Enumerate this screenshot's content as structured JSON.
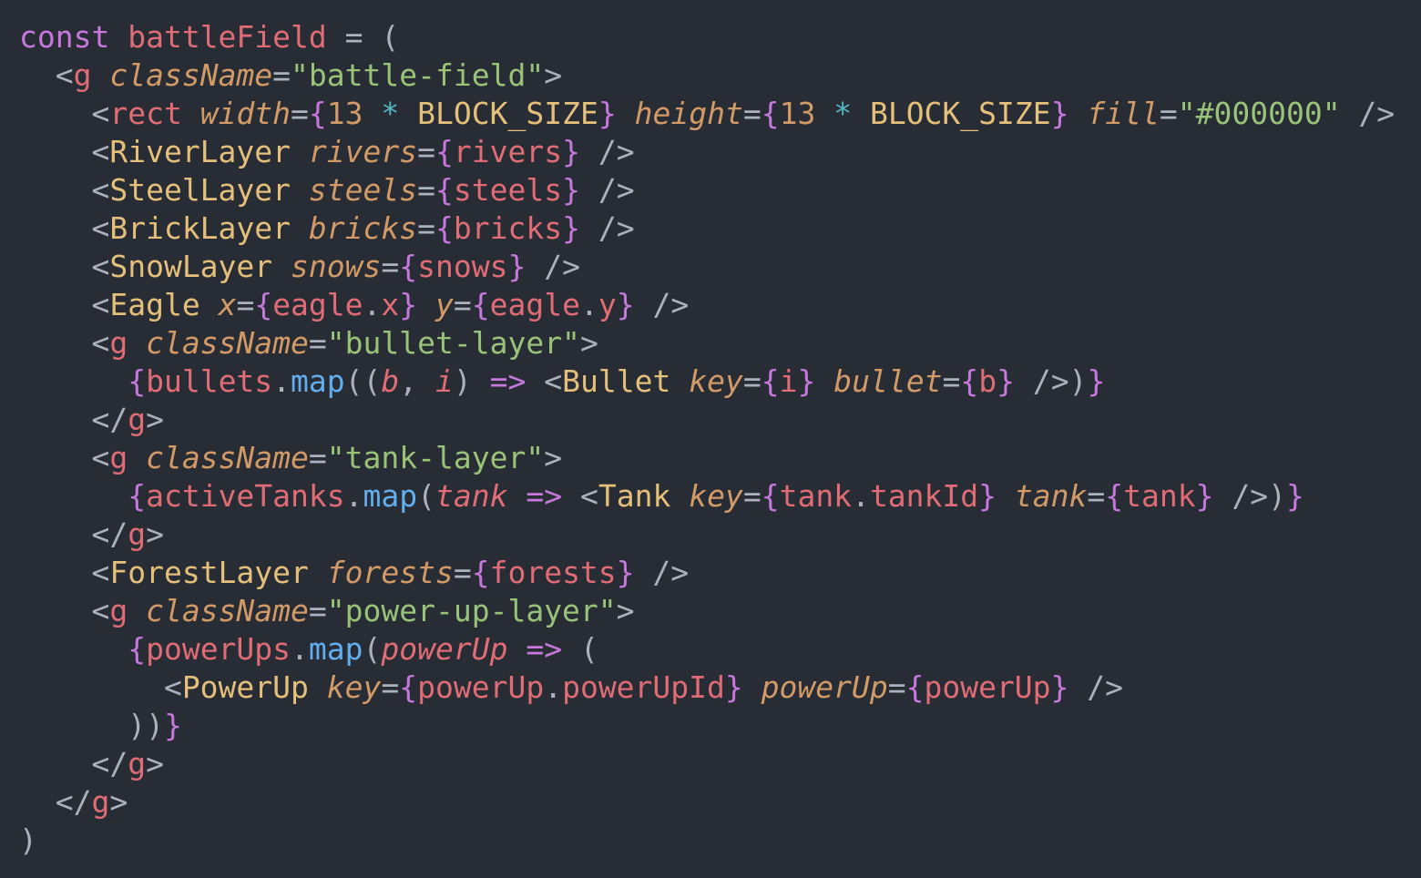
{
  "editor": {
    "theme": "one-dark",
    "background": "#282c34",
    "language": "jsx",
    "lines": [
      [
        [
          "keyword",
          "const"
        ],
        [
          "punct",
          " "
        ],
        [
          "var",
          "battleField"
        ],
        [
          "op",
          " = ("
        ]
      ],
      [
        [
          "punct",
          "  <"
        ],
        [
          "tag",
          "g"
        ],
        [
          "punct",
          " "
        ],
        [
          "attr",
          "className"
        ],
        [
          "op",
          "="
        ],
        [
          "string",
          "\"battle-field\""
        ],
        [
          "punct",
          ">"
        ]
      ],
      [
        [
          "punct",
          "    <"
        ],
        [
          "tag",
          "rect"
        ],
        [
          "punct",
          " "
        ],
        [
          "attr",
          "width"
        ],
        [
          "op",
          "="
        ],
        [
          "brace",
          "{"
        ],
        [
          "number",
          "13"
        ],
        [
          "punct",
          " "
        ],
        [
          "star",
          "*"
        ],
        [
          "punct",
          " "
        ],
        [
          "const",
          "BLOCK_SIZE"
        ],
        [
          "brace",
          "}"
        ],
        [
          "punct",
          " "
        ],
        [
          "attr",
          "height"
        ],
        [
          "op",
          "="
        ],
        [
          "brace",
          "{"
        ],
        [
          "number",
          "13"
        ],
        [
          "punct",
          " "
        ],
        [
          "star",
          "*"
        ],
        [
          "punct",
          " "
        ],
        [
          "const",
          "BLOCK_SIZE"
        ],
        [
          "brace",
          "}"
        ],
        [
          "punct",
          " "
        ],
        [
          "attr",
          "fill"
        ],
        [
          "op",
          "="
        ],
        [
          "string",
          "\"#000000\""
        ],
        [
          "punct",
          " />"
        ]
      ],
      [
        [
          "punct",
          "    <"
        ],
        [
          "component",
          "RiverLayer"
        ],
        [
          "punct",
          " "
        ],
        [
          "attr",
          "rivers"
        ],
        [
          "op",
          "="
        ],
        [
          "brace",
          "{"
        ],
        [
          "ident",
          "rivers"
        ],
        [
          "brace",
          "}"
        ],
        [
          "punct",
          " />"
        ]
      ],
      [
        [
          "punct",
          "    <"
        ],
        [
          "component",
          "SteelLayer"
        ],
        [
          "punct",
          " "
        ],
        [
          "attr",
          "steels"
        ],
        [
          "op",
          "="
        ],
        [
          "brace",
          "{"
        ],
        [
          "ident",
          "steels"
        ],
        [
          "brace",
          "}"
        ],
        [
          "punct",
          " />"
        ]
      ],
      [
        [
          "punct",
          "    <"
        ],
        [
          "component",
          "BrickLayer"
        ],
        [
          "punct",
          " "
        ],
        [
          "attr",
          "bricks"
        ],
        [
          "op",
          "="
        ],
        [
          "brace",
          "{"
        ],
        [
          "ident",
          "bricks"
        ],
        [
          "brace",
          "}"
        ],
        [
          "punct",
          " />"
        ]
      ],
      [
        [
          "punct",
          "    <"
        ],
        [
          "component",
          "SnowLayer"
        ],
        [
          "punct",
          " "
        ],
        [
          "attr",
          "snows"
        ],
        [
          "op",
          "="
        ],
        [
          "brace",
          "{"
        ],
        [
          "ident",
          "snows"
        ],
        [
          "brace",
          "}"
        ],
        [
          "punct",
          " />"
        ]
      ],
      [
        [
          "punct",
          "    <"
        ],
        [
          "component",
          "Eagle"
        ],
        [
          "punct",
          " "
        ],
        [
          "attr",
          "x"
        ],
        [
          "op",
          "="
        ],
        [
          "brace",
          "{"
        ],
        [
          "ident",
          "eagle"
        ],
        [
          "dot",
          "."
        ],
        [
          "prop",
          "x"
        ],
        [
          "brace",
          "}"
        ],
        [
          "punct",
          " "
        ],
        [
          "attr",
          "y"
        ],
        [
          "op",
          "="
        ],
        [
          "brace",
          "{"
        ],
        [
          "ident",
          "eagle"
        ],
        [
          "dot",
          "."
        ],
        [
          "prop",
          "y"
        ],
        [
          "brace",
          "}"
        ],
        [
          "punct",
          " />"
        ]
      ],
      [
        [
          "punct",
          "    <"
        ],
        [
          "tag",
          "g"
        ],
        [
          "punct",
          " "
        ],
        [
          "attr",
          "className"
        ],
        [
          "op",
          "="
        ],
        [
          "string",
          "\"bullet-layer\""
        ],
        [
          "punct",
          ">"
        ]
      ],
      [
        [
          "punct",
          "      "
        ],
        [
          "brace",
          "{"
        ],
        [
          "ident",
          "bullets"
        ],
        [
          "dot",
          "."
        ],
        [
          "method",
          "map"
        ],
        [
          "punct",
          "(("
        ],
        [
          "param",
          "b"
        ],
        [
          "punct",
          ", "
        ],
        [
          "param",
          "i"
        ],
        [
          "punct",
          ") "
        ],
        [
          "arrow",
          "=>"
        ],
        [
          "punct",
          " <"
        ],
        [
          "component",
          "Bullet"
        ],
        [
          "punct",
          " "
        ],
        [
          "attr",
          "key"
        ],
        [
          "op",
          "="
        ],
        [
          "brace",
          "{"
        ],
        [
          "ident",
          "i"
        ],
        [
          "brace",
          "}"
        ],
        [
          "punct",
          " "
        ],
        [
          "attr",
          "bullet"
        ],
        [
          "op",
          "="
        ],
        [
          "brace",
          "{"
        ],
        [
          "ident",
          "b"
        ],
        [
          "brace",
          "}"
        ],
        [
          "punct",
          " />)"
        ],
        [
          "brace",
          "}"
        ]
      ],
      [
        [
          "punct",
          "    </"
        ],
        [
          "tag",
          "g"
        ],
        [
          "punct",
          ">"
        ]
      ],
      [
        [
          "punct",
          "    <"
        ],
        [
          "tag",
          "g"
        ],
        [
          "punct",
          " "
        ],
        [
          "attr",
          "className"
        ],
        [
          "op",
          "="
        ],
        [
          "string",
          "\"tank-layer\""
        ],
        [
          "punct",
          ">"
        ]
      ],
      [
        [
          "punct",
          "      "
        ],
        [
          "brace",
          "{"
        ],
        [
          "ident",
          "activeTanks"
        ],
        [
          "dot",
          "."
        ],
        [
          "method",
          "map"
        ],
        [
          "punct",
          "("
        ],
        [
          "param",
          "tank"
        ],
        [
          "punct",
          " "
        ],
        [
          "arrow",
          "=>"
        ],
        [
          "punct",
          " <"
        ],
        [
          "component",
          "Tank"
        ],
        [
          "punct",
          " "
        ],
        [
          "attr",
          "key"
        ],
        [
          "op",
          "="
        ],
        [
          "brace",
          "{"
        ],
        [
          "ident",
          "tank"
        ],
        [
          "dot",
          "."
        ],
        [
          "prop",
          "tankId"
        ],
        [
          "brace",
          "}"
        ],
        [
          "punct",
          " "
        ],
        [
          "attr",
          "tank"
        ],
        [
          "op",
          "="
        ],
        [
          "brace",
          "{"
        ],
        [
          "ident",
          "tank"
        ],
        [
          "brace",
          "}"
        ],
        [
          "punct",
          " />)"
        ],
        [
          "brace",
          "}"
        ]
      ],
      [
        [
          "punct",
          "    </"
        ],
        [
          "tag",
          "g"
        ],
        [
          "punct",
          ">"
        ]
      ],
      [
        [
          "punct",
          "    <"
        ],
        [
          "component",
          "ForestLayer"
        ],
        [
          "punct",
          " "
        ],
        [
          "attr",
          "forests"
        ],
        [
          "op",
          "="
        ],
        [
          "brace",
          "{"
        ],
        [
          "ident",
          "forests"
        ],
        [
          "brace",
          "}"
        ],
        [
          "punct",
          " />"
        ]
      ],
      [
        [
          "punct",
          "    <"
        ],
        [
          "tag",
          "g"
        ],
        [
          "punct",
          " "
        ],
        [
          "attr",
          "className"
        ],
        [
          "op",
          "="
        ],
        [
          "string",
          "\"power-up-layer\""
        ],
        [
          "punct",
          ">"
        ]
      ],
      [
        [
          "punct",
          "      "
        ],
        [
          "brace",
          "{"
        ],
        [
          "ident",
          "powerUps"
        ],
        [
          "dot",
          "."
        ],
        [
          "method",
          "map"
        ],
        [
          "punct",
          "("
        ],
        [
          "param",
          "powerUp"
        ],
        [
          "punct",
          " "
        ],
        [
          "arrow",
          "=>"
        ],
        [
          "punct",
          " ("
        ]
      ],
      [
        [
          "punct",
          "        <"
        ],
        [
          "component",
          "PowerUp"
        ],
        [
          "punct",
          " "
        ],
        [
          "attr",
          "key"
        ],
        [
          "op",
          "="
        ],
        [
          "brace",
          "{"
        ],
        [
          "ident",
          "powerUp"
        ],
        [
          "dot",
          "."
        ],
        [
          "prop",
          "powerUpId"
        ],
        [
          "brace",
          "}"
        ],
        [
          "punct",
          " "
        ],
        [
          "attr",
          "powerUp"
        ],
        [
          "op",
          "="
        ],
        [
          "brace",
          "{"
        ],
        [
          "ident",
          "powerUp"
        ],
        [
          "brace",
          "}"
        ],
        [
          "punct",
          " />"
        ]
      ],
      [
        [
          "punct",
          "      ))"
        ],
        [
          "brace",
          "}"
        ]
      ],
      [
        [
          "punct",
          "    </"
        ],
        [
          "tag",
          "g"
        ],
        [
          "punct",
          ">"
        ]
      ],
      [
        [
          "punct",
          "  </"
        ],
        [
          "tag",
          "g"
        ],
        [
          "punct",
          ">"
        ]
      ],
      [
        [
          "punct",
          ")"
        ]
      ]
    ]
  }
}
